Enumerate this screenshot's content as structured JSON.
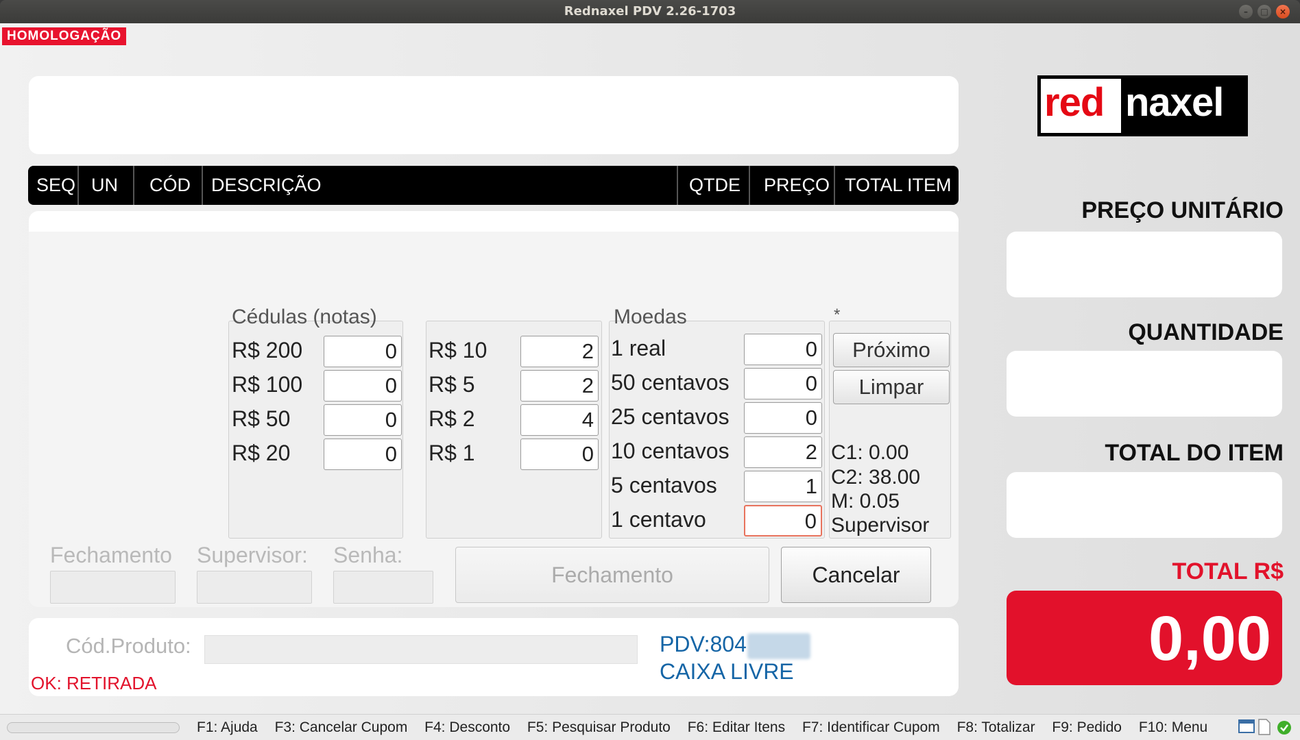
{
  "window": {
    "title": "Rednaxel PDV 2.26-1703"
  },
  "environment_badge": "HOMOLOGAÇÃO",
  "table_header": {
    "seq": "SEQ",
    "un": "UN",
    "cod": "CÓD",
    "descricao": "DESCRIÇÃO",
    "qtde": "QTDE",
    "preco": "PREÇO",
    "total_item": "TOTAL ITEM"
  },
  "cedulas": {
    "legend": "Cédulas (notas)",
    "col1": [
      {
        "label": "R$ 200",
        "value": "0"
      },
      {
        "label": "R$ 100",
        "value": "0"
      },
      {
        "label": "R$ 50",
        "value": "0"
      },
      {
        "label": "R$ 20",
        "value": "0"
      }
    ],
    "col2": [
      {
        "label": "R$ 10",
        "value": "2"
      },
      {
        "label": "R$ 5",
        "value": "2"
      },
      {
        "label": "R$ 2",
        "value": "4"
      },
      {
        "label": "R$ 1",
        "value": "0"
      }
    ]
  },
  "moedas": {
    "legend": "Moedas",
    "items": [
      {
        "label": "1 real",
        "value": "0"
      },
      {
        "label": "50 centavos",
        "value": "0"
      },
      {
        "label": "25 centavos",
        "value": "0"
      },
      {
        "label": "10 centavos",
        "value": "2"
      },
      {
        "label": "5 centavos",
        "value": "1"
      },
      {
        "label": "1 centavo",
        "value": "0"
      }
    ]
  },
  "side": {
    "legend": "*",
    "proximo": "Próximo",
    "limpar": "Limpar",
    "c1": "C1: 0.00",
    "c2": "C2: 38.00",
    "m": "M: 0.05",
    "supervisor": "Supervisor"
  },
  "fechamento_row": {
    "fechamento_label": "Fechamento",
    "supervisor_label": "Supervisor:",
    "senha_label": "Senha:",
    "fechamento_button": "Fechamento",
    "cancelar_button": "Cancelar"
  },
  "bottom": {
    "cod_produto_label": "Cód.Produto:",
    "ok_message": "OK: RETIRADA",
    "pdv": "PDV:804",
    "caixa_status": "CAIXA LIVRE"
  },
  "right": {
    "logo_red": "red",
    "logo_white": "naxel",
    "preco_unitario": "PREÇO UNITÁRIO",
    "quantidade": "QUANTIDADE",
    "total_do_item": "TOTAL DO ITEM",
    "total_label": "TOTAL R$",
    "total_value": "0,00"
  },
  "statusbar": {
    "keys": [
      "F1: Ajuda",
      "F3: Cancelar Cupom",
      "F4: Desconto",
      "F5: Pesquisar Produto",
      "F6: Editar Itens",
      "F7: Identificar Cupom",
      "F8: Totalizar",
      "F9: Pedido",
      "F10: Menu"
    ]
  },
  "colors": {
    "accent_red": "#e2122b",
    "blue_text": "#1565a6"
  }
}
